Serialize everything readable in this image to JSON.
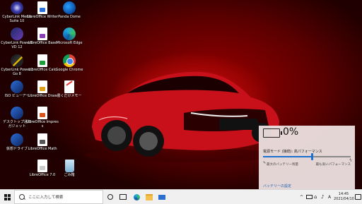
{
  "desktop": {
    "icons": [
      {
        "label": "CyberLink Media Suite 10"
      },
      {
        "label": "CyberLink PowerDVD 12"
      },
      {
        "label": "CyberLink Power2Go 8"
      },
      {
        "label": "ISO ビューアー"
      },
      {
        "label": "デスクトップ通知 ガジェット"
      },
      {
        "label": "仮想ドライブ"
      },
      {
        "label": "LibreOffice Writer"
      },
      {
        "label": "LibreOffice Base"
      },
      {
        "label": "LibreOffice Calc"
      },
      {
        "label": "LibreOffice Draw"
      },
      {
        "label": "LibreOffice Impress"
      },
      {
        "label": "LibreOffice Math"
      },
      {
        "label": "LibreOffice 7.0"
      },
      {
        "label": "Panda Dome"
      },
      {
        "label": "Microsoft Edge"
      },
      {
        "label": "Google Chrome"
      },
      {
        "label": "書くだけメモー"
      },
      {
        "label": "ごみ箱"
      }
    ]
  },
  "battery_flyout": {
    "percent": "0%",
    "power_mode_label": "電源モード (接続): 高パフォーマンス",
    "slider_level": 0.56,
    "low_label": "最大のバッテリー残量",
    "high_label": "最も高いパフォーマンス",
    "settings_link": "バッテリーの設定"
  },
  "taskbar": {
    "search_placeholder": "ここに入力して検索",
    "ime": "A",
    "time": "14:45",
    "date": "2021/04/10"
  },
  "colors": {
    "accent": "#1a6fcf",
    "wallpaper": "#b00808"
  }
}
